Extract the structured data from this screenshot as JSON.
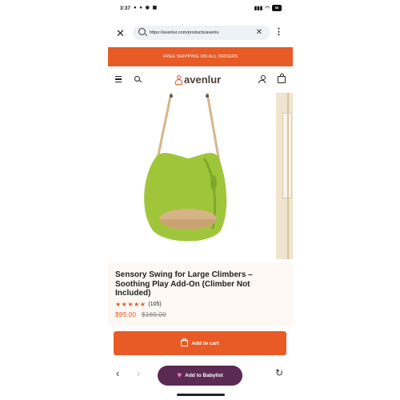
{
  "status_bar": {
    "time": "3:37",
    "battery": "58"
  },
  "browser": {
    "url": "https://avenlur.com/products/avenlu"
  },
  "promo": {
    "text": "FREE SHIPPING ON ALL ORDERS"
  },
  "site": {
    "logo_text": "avenlur"
  },
  "product": {
    "title": "Sensory Swing for Large Climbers – Soothing Play Add-On (Climber Not Included)",
    "stars": "★★★★★",
    "review_count": "(105)",
    "price": "$99.00",
    "compare_price": "$169.00",
    "image_colors": {
      "swing": "#9fc63a",
      "swing_shadow": "#7fa82a",
      "seat": "#d7b487",
      "straps": "#d8b58a"
    }
  },
  "cart": {
    "button_label": "Add to cart"
  },
  "bottom_bar": {
    "babylist_label": "Add to Babylist"
  },
  "icons": [
    "close-icon",
    "search-icon",
    "clear-icon",
    "more-icon",
    "menu-icon",
    "user-icon",
    "bag-icon",
    "cart-icon",
    "back-icon",
    "forward-icon",
    "heart-icon",
    "reload-icon"
  ],
  "colors": {
    "accent": "#e85a26",
    "babylist": "#5a2a55"
  }
}
